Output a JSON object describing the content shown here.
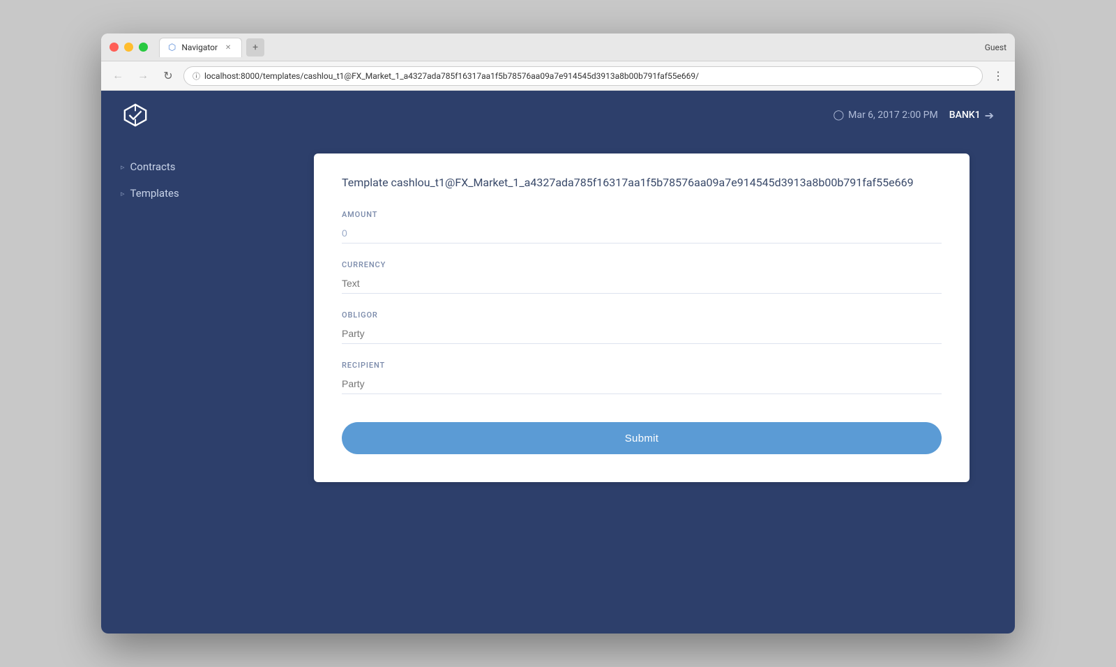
{
  "titlebar": {
    "tab_label": "Navigator",
    "guest_label": "Guest"
  },
  "addressbar": {
    "url": "localhost:8000/templates/cashlou_t1@FX_Market_1_a4327ada785f16317aa1f5b78576aa09a7e914545d3913a8b00b791faf55e669/"
  },
  "header": {
    "timestamp": "Mar 6, 2017 2:00 PM",
    "user": "BANK1"
  },
  "sidebar": {
    "items": [
      {
        "label": "Contracts"
      },
      {
        "label": "Templates"
      }
    ]
  },
  "form": {
    "title": "Template cashlou_t1@FX_Market_1_a4327ada785f16317aa1f5b78576aa09a7e914545d3913a8b00b791faf55e669",
    "fields": [
      {
        "label": "AMOUNT",
        "placeholder": "0",
        "type": "number"
      },
      {
        "label": "CURRENCY",
        "placeholder": "Text",
        "type": "text"
      },
      {
        "label": "OBLIGOR",
        "placeholder": "Party",
        "type": "text"
      },
      {
        "label": "RECIPIENT",
        "placeholder": "Party",
        "type": "text"
      }
    ],
    "submit_label": "Submit"
  }
}
